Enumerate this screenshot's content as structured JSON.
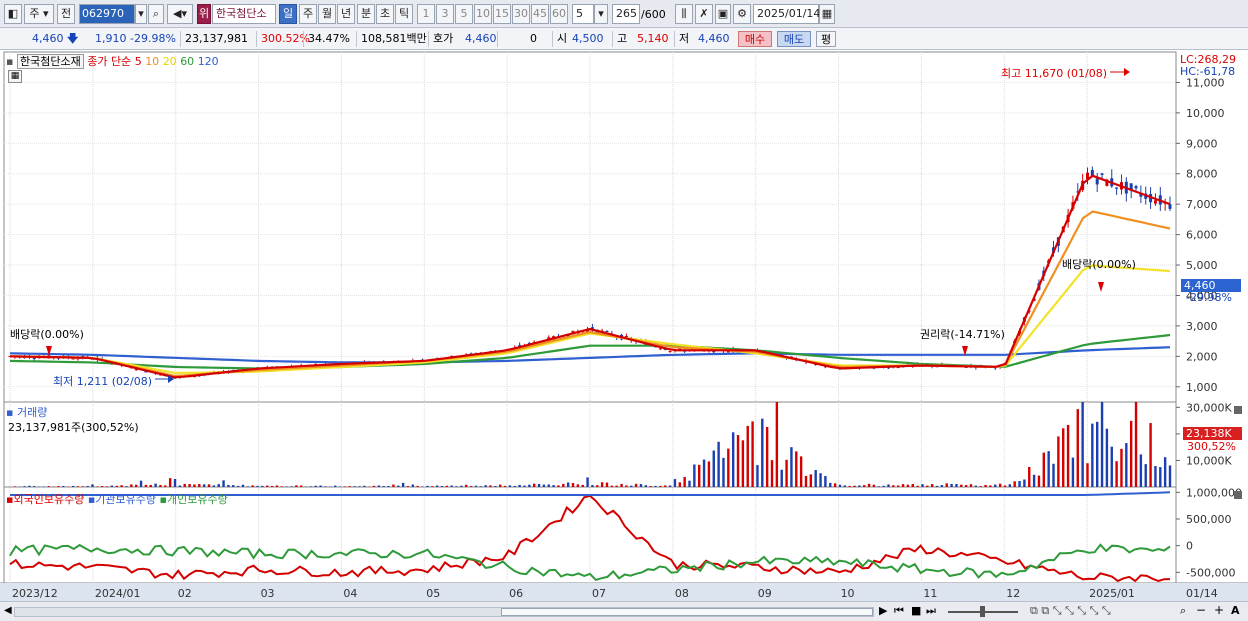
{
  "toolbar": {
    "period_mode": "주",
    "prev_label": "전",
    "code": "062970",
    "chart_kind_label": "위",
    "stock_name": "한국첨단소",
    "intervals": [
      "일",
      "주",
      "월",
      "년",
      "분",
      "초",
      "틱"
    ],
    "active_interval": "일",
    "multipliers": [
      "1",
      "3",
      "5",
      "10",
      "15",
      "30",
      "45",
      "60"
    ],
    "count_select": "5",
    "bar_count": "265",
    "bar_max": "/600",
    "date": "2025/01/14"
  },
  "quote": {
    "price": "4,460",
    "change": "1,910",
    "change_pct": "-29.98%",
    "volume": "23,137,981",
    "volume_ratio": "300.52%",
    "turnover": "34.47%",
    "amount": "108,581백만",
    "bid_label": "호가",
    "bid": "4,460",
    "bid_qty": "0",
    "open_label": "시",
    "open": "4,500",
    "high_label": "고",
    "high": "5,140",
    "low_label": "저",
    "low": "4,460",
    "buy_label": "매수",
    "sell_label": "매도",
    "eval_label": "평"
  },
  "price_panel": {
    "name": "한국첨단소재",
    "ma_prefix": "종가 단순",
    "ma_periods": [
      "5",
      "10",
      "20",
      "60",
      "120"
    ],
    "lc": "LC:268,29",
    "hc": "HC:-61,78",
    "current_price_tag": "4,460",
    "current_pct_tag": "-29.98%",
    "annotations": {
      "high": "최고 11,670 (01/08)",
      "low": "최저 1,211 (02/08)",
      "dividend_left": "배당락(0.00%)",
      "dividend_right": "배당락(0.00%)",
      "rights": "권리락(-14.71%)"
    }
  },
  "volume_panel": {
    "title": "거래량",
    "summary": "23,137,981주(300,52%)",
    "current_tag": "23,138K",
    "current_pct": "300,52%"
  },
  "holdings_panel": {
    "series_labels": [
      "외국인보유수량",
      "기관보유수량",
      "개인보유수량"
    ]
  },
  "time_axis": [
    "2023/12",
    "2024/01",
    "02",
    "03",
    "04",
    "05",
    "06",
    "07",
    "08",
    "09",
    "10",
    "11",
    "12",
    "2025/01",
    "01/14"
  ],
  "colors": {
    "ma5": "#d40000",
    "ma10": "#f09020",
    "ma20": "#f2e22a",
    "ma60": "#2e9a3a",
    "ma120": "#2f5fd0",
    "up": "#d40000",
    "down": "#1b3fb0",
    "accent": "#2b63b8"
  },
  "chart_data": [
    {
      "type": "line",
      "title": "한국첨단소재",
      "y_axis_ticks": [
        "11,000",
        "10,000",
        "9,000",
        "8,000",
        "7,000",
        "6,000",
        "5,000",
        "4,000",
        "3,000",
        "2,000",
        "1,000"
      ],
      "ylim": [
        500,
        12000
      ],
      "x": [
        "2023/12",
        "2024/01",
        "02",
        "03",
        "04",
        "05",
        "06",
        "07",
        "08",
        "09",
        "10",
        "11",
        "12",
        "2025/01",
        "01/14"
      ],
      "series": [
        {
          "name": "5",
          "values": [
            2000,
            1950,
            1300,
            1600,
            1750,
            1850,
            2200,
            2900,
            2200,
            2200,
            1600,
            1700,
            1650,
            8000,
            7000
          ]
        },
        {
          "name": "10",
          "values": [
            2000,
            1950,
            1350,
            1550,
            1700,
            1850,
            2150,
            2800,
            2300,
            2150,
            1650,
            1700,
            1650,
            6800,
            6200
          ]
        },
        {
          "name": "20",
          "values": [
            2000,
            1950,
            1450,
            1500,
            1650,
            1800,
            2100,
            2750,
            2400,
            2100,
            1700,
            1700,
            1650,
            5000,
            4800
          ]
        },
        {
          "name": "60",
          "values": [
            1850,
            1800,
            1650,
            1600,
            1650,
            1750,
            1950,
            2350,
            2350,
            2200,
            1950,
            1750,
            1650,
            2400,
            2700
          ]
        },
        {
          "name": "120",
          "values": [
            2100,
            2050,
            1950,
            1850,
            1800,
            1800,
            1850,
            1950,
            2050,
            2100,
            2050,
            2050,
            2050,
            2200,
            2300
          ]
        }
      ]
    },
    {
      "type": "bar",
      "title": "거래량",
      "y_axis_ticks": [
        "30,000K",
        "20,000K",
        "10,000K"
      ],
      "ylim": [
        0,
        32000
      ],
      "x": [
        "2023/12",
        "2024/01",
        "02",
        "03",
        "04",
        "05",
        "06",
        "07",
        "08",
        "09",
        "10",
        "11",
        "12",
        "2025/01",
        "01/14"
      ],
      "values": [
        300,
        400,
        1500,
        700,
        500,
        600,
        900,
        1800,
        800,
        28000,
        600,
        1200,
        900,
        29000,
        23138
      ]
    },
    {
      "type": "line",
      "title": "보유수량",
      "y_axis_ticks": [
        "1,000,000",
        "500,000",
        "0",
        "-500,000"
      ],
      "ylim": [
        -700000,
        1100000
      ],
      "x": [
        "2023/12",
        "2024/01",
        "02",
        "03",
        "04",
        "05",
        "06",
        "07",
        "08",
        "09",
        "10",
        "11",
        "12",
        "2025/01",
        "01/14"
      ],
      "series": [
        {
          "name": "외국인보유수량",
          "values": [
            -350000,
            -400000,
            -550000,
            -450000,
            -500000,
            -450000,
            -200000,
            950000,
            -350000,
            -400000,
            -500000,
            -50000,
            -300000,
            -600000,
            -600000
          ]
        },
        {
          "name": "기관보유수량",
          "values": [
            950000,
            950000,
            950000,
            950000,
            950000,
            950000,
            950000,
            950000,
            950000,
            950000,
            950000,
            950000,
            950000,
            950000,
            1000000
          ]
        },
        {
          "name": "개인보유수량",
          "values": [
            -100000,
            -50000,
            -100000,
            -150000,
            -150000,
            -150000,
            -400000,
            -600000,
            -450000,
            -300000,
            -300000,
            -450000,
            -550000,
            -50000,
            -100000
          ]
        }
      ]
    }
  ]
}
